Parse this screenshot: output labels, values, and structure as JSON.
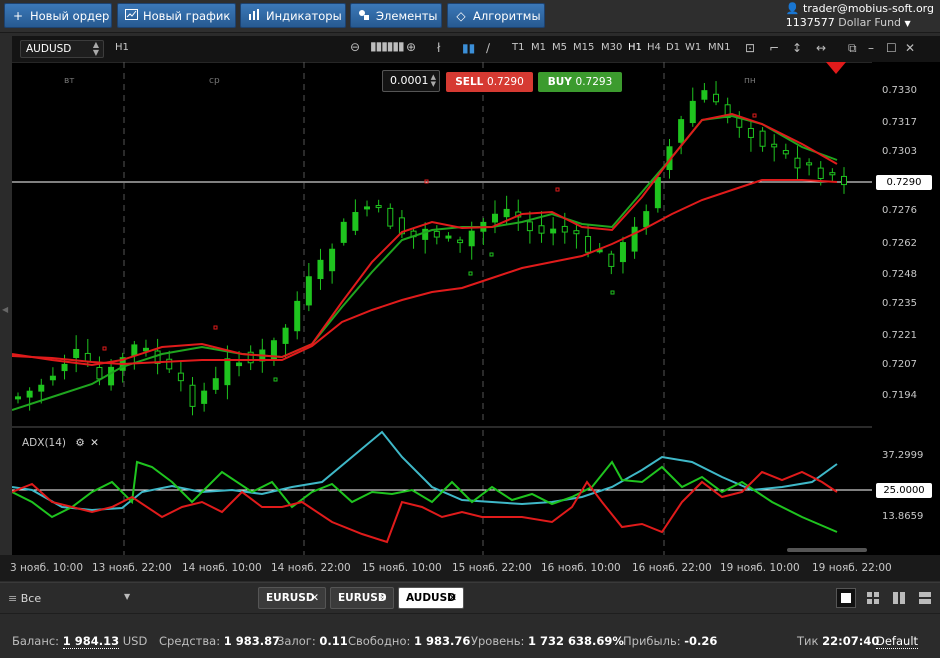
{
  "toolbar_top": {
    "buttons": [
      {
        "label": "Новый ордер",
        "icon": "plus-icon"
      },
      {
        "label": "Новый график",
        "icon": "chart-icon"
      },
      {
        "label": "Индикаторы",
        "icon": "bars-icon"
      },
      {
        "label": "Элементы",
        "icon": "elements-icon"
      },
      {
        "label": "Алгоритмы",
        "icon": "diamond-icon"
      }
    ],
    "account_email": "trader@mobius-soft.org",
    "account_id": "1137577",
    "account_fund": "Dollar Fund"
  },
  "chart_toolbar": {
    "symbol": "AUDUSD",
    "timeframe": "H1",
    "timeframes": [
      "T1",
      "M1",
      "M5",
      "M15",
      "M30",
      "H1",
      "H4",
      "D1",
      "W1",
      "MN1"
    ],
    "active_timeframe": "H1"
  },
  "quote": {
    "volume": "0.0001",
    "sell_label": "SELL",
    "sell_price": "0.7290",
    "buy_label": "BUY",
    "buy_price": "0.7293"
  },
  "days": [
    "вт",
    "ср",
    "пн"
  ],
  "price_axis": {
    "labels": [
      "0.7330",
      "0.7317",
      "0.7303",
      "0.7276",
      "0.7262",
      "0.7248",
      "0.7235",
      "0.7221",
      "0.7207",
      "0.7194"
    ],
    "current": "0.7290"
  },
  "indicator": {
    "label": "ADX(14)",
    "axis_labels": [
      "37.2999",
      "13.8659"
    ],
    "level": "25.0000"
  },
  "time_axis": [
    "3 нояб. 10:00",
    "13 нояб. 22:00",
    "14 нояб. 10:00",
    "14 нояб. 22:00",
    "15 нояб. 10:00",
    "15 нояб. 22:00",
    "16 нояб. 10:00",
    "16 нояб. 22:00",
    "19 нояб. 10:00",
    "19 нояб. 22:00"
  ],
  "tabs_bar": {
    "filter": "Все",
    "tabs": [
      {
        "label": "EURUSD"
      },
      {
        "label": "EURUSD"
      },
      {
        "label": "AUDUSD"
      }
    ],
    "close_glyph": "✕"
  },
  "status": {
    "balance_label": "Баланс:",
    "balance_value": "1 984.13",
    "balance_currency": "USD",
    "equity_label": "Средства:",
    "equity_value": "1 983.87",
    "margin_label": "Залог:",
    "margin_value": "0.11",
    "free_label": "Свободно:",
    "free_value": "1 983.76",
    "level_label": "Уровень:",
    "level_value": "1 732 638.69%",
    "profit_label": "Прибыль:",
    "profit_value": "-0.26",
    "tick_label": "Тик",
    "tick_value": "22:07:40",
    "default_label": "Default"
  },
  "colors": {
    "green": "#1fc41f",
    "red": "#e01b1b",
    "cyan": "#3fb8c8",
    "sell": "#d63a32",
    "buy": "#3c9b2e",
    "accent": "#3b78b8"
  }
}
